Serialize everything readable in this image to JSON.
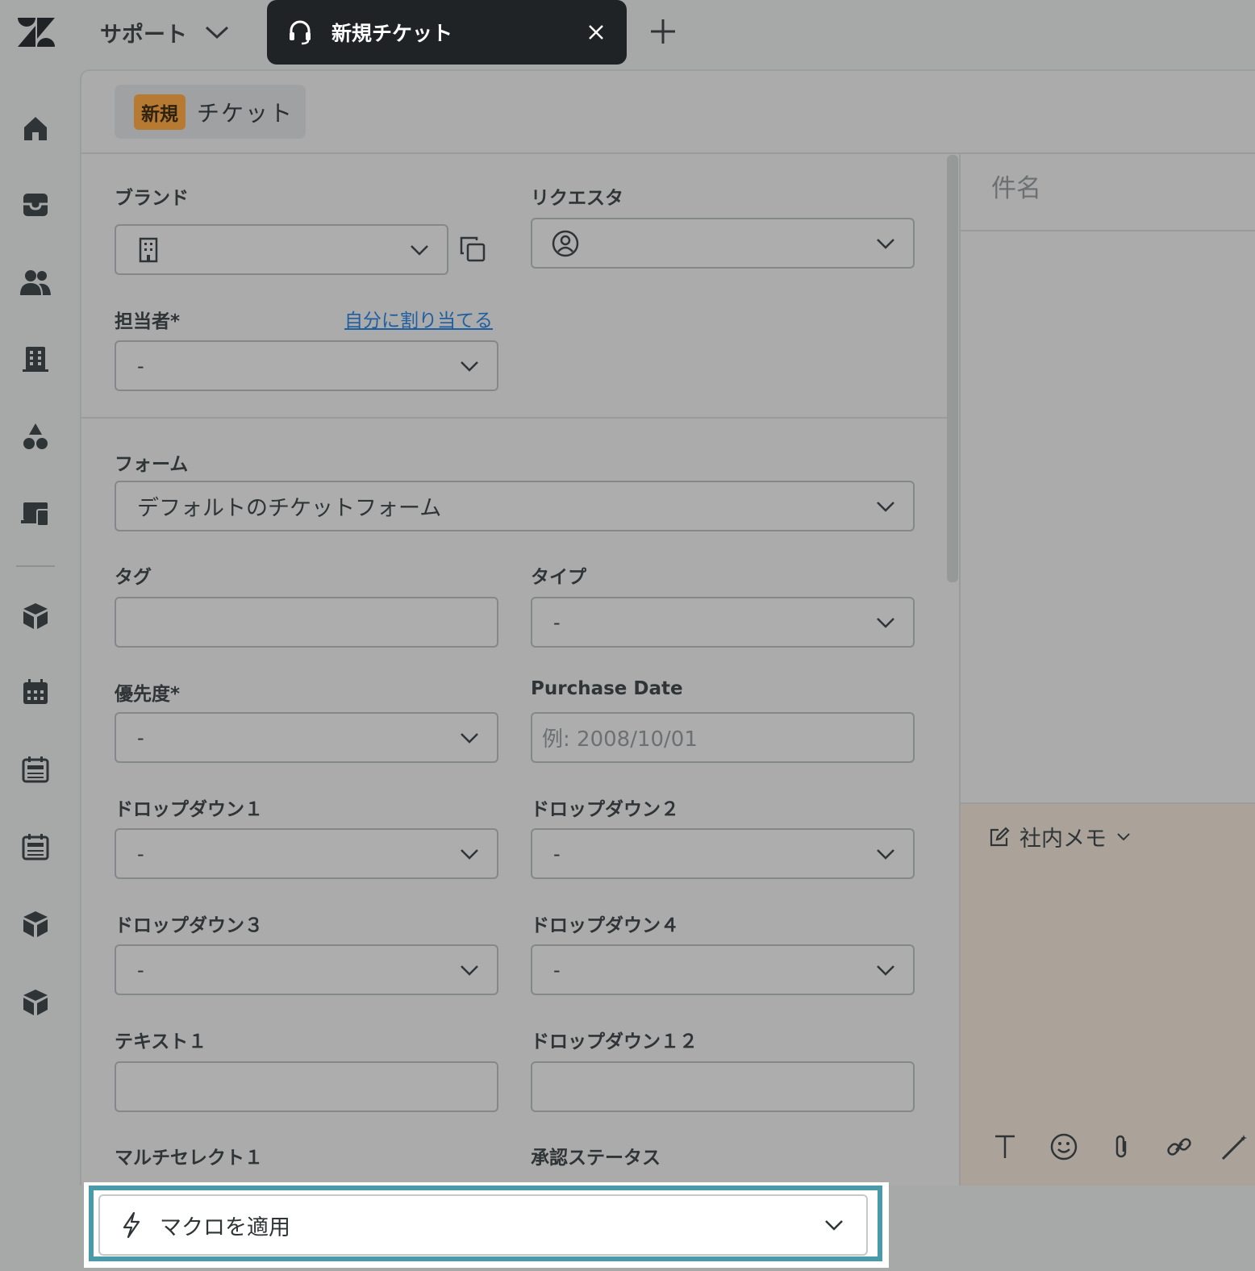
{
  "header": {
    "product": "サポート",
    "active_tab": "新規チケット"
  },
  "ticket": {
    "status_badge": "新規",
    "title": "チケット"
  },
  "fields": {
    "brand": {
      "label": "ブランド",
      "value": ""
    },
    "requester": {
      "label": "リクエスタ",
      "value": ""
    },
    "assignee": {
      "label": "担当者*",
      "value": "-",
      "assign_self": "自分に割り当てる"
    },
    "form": {
      "label": "フォーム",
      "value": "デフォルトのチケットフォーム"
    },
    "tags": {
      "label": "タグ",
      "value": ""
    },
    "type": {
      "label": "タイプ",
      "value": "-"
    },
    "priority": {
      "label": "優先度*",
      "value": "-"
    },
    "purchase_date": {
      "label": "Purchase Date",
      "placeholder": "例: 2008/10/01"
    },
    "dropdown1": {
      "label": "ドロップダウン１",
      "value": "-"
    },
    "dropdown2": {
      "label": "ドロップダウン２",
      "value": "-"
    },
    "dropdown3": {
      "label": "ドロップダウン３",
      "value": "-"
    },
    "dropdown4": {
      "label": "ドロップダウン４",
      "value": "-"
    },
    "text1": {
      "label": "テキスト１",
      "value": ""
    },
    "dropdown12": {
      "label": "ドロップダウン１２",
      "value": ""
    },
    "multiselect1": {
      "label": "マルチセレクト１"
    },
    "approval_status": {
      "label": "承認ステータス"
    }
  },
  "conversation": {
    "subject_placeholder": "件名",
    "composer_mode": "社内メモ"
  },
  "footer": {
    "macro_label": "マクロを適用"
  },
  "colors": {
    "accent_outline": "#4a9aaa",
    "new_badge": "#b77a33",
    "link": "#1f5fa0"
  },
  "icons": [
    "zendesk-logo",
    "headset-icon",
    "home-icon",
    "inbox-icon",
    "users-icon",
    "building-icon",
    "shapes-icon",
    "devices-icon",
    "box-icon",
    "calendar-icon",
    "news-icon",
    "pencil-note-icon",
    "text-format-icon",
    "emoji-icon",
    "paperclip-icon",
    "link-icon",
    "magic-wand-icon",
    "lightning-icon"
  ]
}
